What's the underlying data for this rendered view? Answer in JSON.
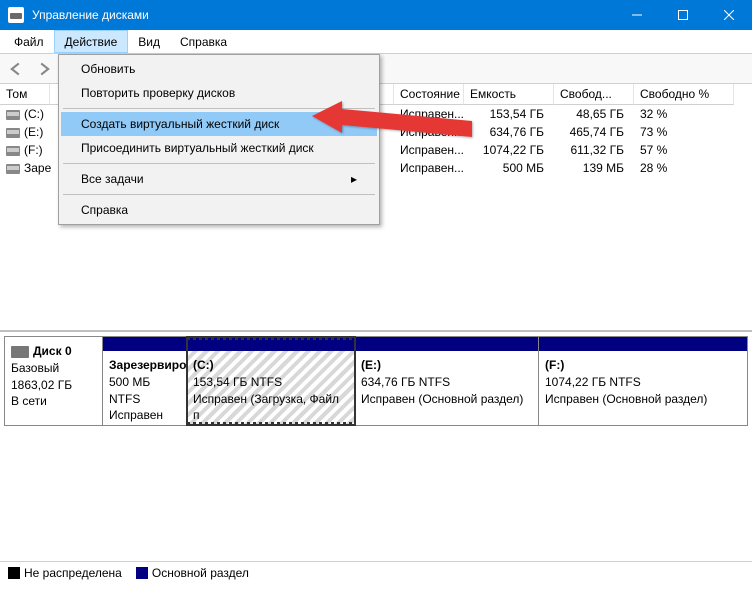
{
  "window": {
    "title": "Управление дисками"
  },
  "menu": {
    "file": "Файл",
    "action": "Действие",
    "view": "Вид",
    "help": "Справка"
  },
  "dropdown": {
    "refresh": "Обновить",
    "rescan": "Повторить проверку дисков",
    "create_vhd": "Создать виртуальный жесткий диск",
    "attach_vhd": "Присоединить виртуальный жесткий диск",
    "all_tasks": "Все задачи",
    "help": "Справка"
  },
  "columns": {
    "tom": "Том",
    "state": "Состояние",
    "capacity": "Емкость",
    "free": "Свобод...",
    "free_pct": "Свободно %"
  },
  "volumes": [
    {
      "name": "(C:)",
      "state": "Исправен...",
      "cap": "153,54 ГБ",
      "free": "48,65 ГБ",
      "pct": "32 %"
    },
    {
      "name": "(E:)",
      "state": "Исправен...",
      "cap": "634,76 ГБ",
      "free": "465,74 ГБ",
      "pct": "73 %"
    },
    {
      "name": "(F:)",
      "state": "Исправен...",
      "cap": "1074,22 ГБ",
      "free": "611,32 ГБ",
      "pct": "57 %"
    },
    {
      "name": "Заре",
      "state": "Исправен...",
      "cap": "500 МБ",
      "free": "139 МБ",
      "pct": "28 %"
    }
  ],
  "disk": {
    "label": "Диск 0",
    "type": "Базовый",
    "size": "1863,02 ГБ",
    "status": "В сети",
    "parts": [
      {
        "name": "Зарезервиро",
        "sub": "500 МБ NTFS",
        "stat": "Исправен (Си"
      },
      {
        "name": "(C:)",
        "sub": "153,54 ГБ NTFS",
        "stat": "Исправен (Загрузка, Файл п"
      },
      {
        "name": "(E:)",
        "sub": "634,76 ГБ NTFS",
        "stat": "Исправен (Основной раздел)"
      },
      {
        "name": "(F:)",
        "sub": "1074,22 ГБ NTFS",
        "stat": "Исправен (Основной раздел)"
      }
    ]
  },
  "legend": {
    "unalloc": "Не распределена",
    "primary": "Основной раздел"
  }
}
